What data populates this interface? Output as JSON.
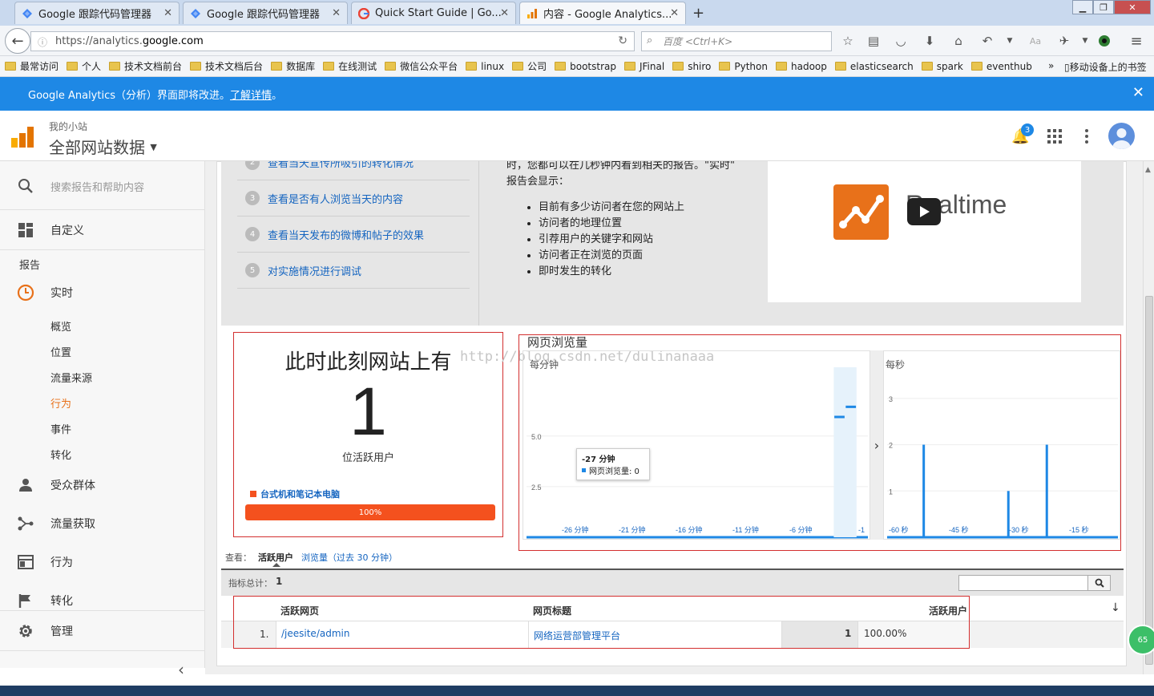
{
  "browser": {
    "tabs": [
      {
        "title": "Google 跟踪代码管理器",
        "icon": "gtm-icon",
        "active": false
      },
      {
        "title": "Google 跟踪代码管理器",
        "icon": "gtm-icon",
        "active": false
      },
      {
        "title": "Quick Start Guide | Go...",
        "icon": "google-icon",
        "active": false
      },
      {
        "title": "内容 - Google Analytics...",
        "icon": "analytics-icon",
        "active": true
      }
    ],
    "url_prefix": "https://analytics.",
    "url_domain": "google.com",
    "search_placeholder": "百度 <Ctrl+K>",
    "bookmarks": [
      "最常访问",
      "个人",
      "技术文档前台",
      "技术文档后台",
      "数据库",
      "在线测试",
      "微信公众平台",
      "linux",
      "公司",
      "bootstrap",
      "JFinal",
      "shiro",
      "Python",
      "hadoop",
      "elasticsearch",
      "spark",
      "eventhub"
    ],
    "bookmarks_more": "»",
    "mobile_bookmarks": "移动设备上的书签"
  },
  "banner": {
    "text": "Google Analytics（分析）界面即将改进。",
    "link": "了解详情",
    "end": "。"
  },
  "header": {
    "account": "我的小站",
    "property": "全部网站数据",
    "notification_count": "3"
  },
  "sidebar": {
    "search_placeholder": "搜索报告和帮助内容",
    "customize": "自定义",
    "reports_heading": "报告",
    "realtime": "实时",
    "realtime_sub": [
      "概览",
      "位置",
      "流量来源",
      "行为",
      "事件",
      "转化"
    ],
    "audience": "受众群体",
    "acquisition": "流量获取",
    "behavior": "行为",
    "conversions": "转化",
    "admin": "管理",
    "collapse": "‹"
  },
  "guide": {
    "items": [
      {
        "num": "2",
        "text": "查看当天宣传所吸引的转化情况"
      },
      {
        "num": "3",
        "text": "查看是否有人浏览当天的内容"
      },
      {
        "num": "4",
        "text": "查看当天发布的微博和帖子的效果"
      },
      {
        "num": "5",
        "text": "对实施情况进行调试"
      }
    ],
    "intro_line1": "时，您都可以在几秒钟内看到相关的报告。\"实时\"",
    "intro_line2": "报告会显示：",
    "bullets": [
      "目前有多少访问者在您的网站上",
      "访问者的地理位置",
      "引荐用户的关键字和网站",
      "访问者正在浏览的页面",
      "即时发生的转化"
    ],
    "video_title": "Realtime"
  },
  "active_users": {
    "heading": "此时此刻网站上有",
    "count": "1",
    "label": "位活跃用户",
    "device_label": "台式机和笔记本电脑",
    "device_percent": "100%",
    "device_fraction": 1.0,
    "device_color": "#f4511e"
  },
  "watermark": "http://blog.csdn.net/dulinanaaa",
  "pageviews": {
    "title": "网页浏览量",
    "per_minute_label": "每分钟",
    "per_second_label": "每秒",
    "tooltip_title": "-27 分钟",
    "tooltip_series": "网页浏览量: 0",
    "expand": "›"
  },
  "chart_data": [
    {
      "type": "bar",
      "title": "每分钟",
      "x": [
        -30,
        -29,
        -28,
        -27,
        -26,
        -25,
        -24,
        -23,
        -22,
        -21,
        -20,
        -19,
        -18,
        -17,
        -16,
        -15,
        -14,
        -13,
        -12,
        -11,
        -10,
        -9,
        -8,
        -7,
        -6,
        -5,
        -4,
        -3,
        -2,
        -1
      ],
      "values": [
        0,
        0,
        0,
        0,
        0,
        0,
        0,
        0,
        0,
        0,
        0,
        0,
        0,
        0,
        0,
        0,
        0,
        0,
        0,
        0,
        0,
        0,
        0,
        0,
        0,
        0,
        0,
        6,
        6.5,
        0
      ],
      "xticks": [
        "-26 分钟",
        "-21 分钟",
        "-16 分钟",
        "-11 分钟",
        "-6 分钟",
        "-1"
      ],
      "yticks": [
        "2.5",
        "5.0"
      ],
      "ylim": [
        0,
        8
      ],
      "color": "#1e88e5"
    },
    {
      "type": "bar",
      "title": "每秒",
      "x": [
        -60,
        -59,
        -58,
        -57,
        -56,
        -55,
        -54,
        -53,
        -52,
        -51,
        -50,
        -49,
        -48,
        -47,
        -46,
        -45,
        -44,
        -43,
        -42,
        -41,
        -40,
        -39,
        -38,
        -37,
        -36,
        -35,
        -34,
        -33,
        -32,
        -31,
        -30,
        -29,
        -28,
        -27,
        -26,
        -25,
        -24,
        -23,
        -22,
        -21,
        -20,
        -19,
        -18,
        -17,
        -16,
        -15,
        -14,
        -13,
        -12,
        -11,
        -10,
        -9,
        -8,
        -7,
        -6,
        -5,
        -4,
        -3,
        -2,
        -1
      ],
      "values": [
        0,
        0,
        0,
        0,
        0,
        0,
        0,
        0,
        0,
        2,
        0,
        0,
        0,
        0,
        0,
        0,
        0,
        0,
        0,
        0,
        0,
        0,
        0,
        0,
        0,
        0,
        0,
        0,
        0,
        0,
        0,
        1,
        0,
        0,
        0,
        0,
        0,
        0,
        0,
        0,
        0,
        2,
        0,
        0,
        0,
        0,
        0,
        0,
        0,
        0,
        0,
        0,
        0,
        0,
        0,
        0,
        0,
        0,
        0,
        0
      ],
      "xticks": [
        "-60 秒",
        "-45 秒",
        "-30 秒",
        "-15 秒"
      ],
      "yticks": [
        "1",
        "2",
        "3"
      ],
      "ylim": [
        0,
        3.5
      ],
      "color": "#1e88e5"
    }
  ],
  "table_controls": {
    "view_label": "查看：",
    "tab_active": "活跃用户",
    "tab_pageviews": "浏览量（过去 30 分钟）",
    "total_label": "指标总计：",
    "total_value": "1"
  },
  "table": {
    "columns": [
      "活跃网页",
      "网页标题",
      "活跃用户"
    ],
    "rows": [
      {
        "index": "1.",
        "page": "/jeesite/admin",
        "title": "网络运营部管理平台",
        "users": "1",
        "percent": "100.00%"
      }
    ]
  },
  "badge_text": "65"
}
